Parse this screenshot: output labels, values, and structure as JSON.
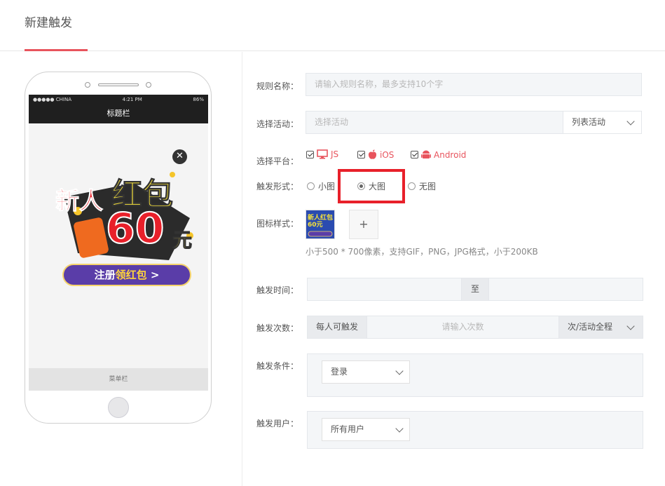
{
  "header": {
    "title": "新建触发"
  },
  "phone": {
    "carrier": "●●●●● CHINA",
    "time": "4:21 PM",
    "battery": "86%",
    "title_bar": "标题栏",
    "menu_bar": "菜单栏",
    "close_glyph": "✕",
    "promo": {
      "line1a": "新人",
      "line1b": "红包",
      "amount": "60",
      "unit": "元",
      "cta": "注册领红包 >",
      "cta_head": "注册",
      "cta_highlight": "领红包",
      "cta_tail": " >"
    }
  },
  "form": {
    "rule_name": {
      "label": "规则名称：",
      "placeholder": "请输入规则名称，最多支持10个字"
    },
    "activity": {
      "label": "选择活动：",
      "placeholder": "选择活动",
      "select_value": "列表活动"
    },
    "platform": {
      "label": "选择平台：",
      "options": [
        {
          "label": "JS",
          "checked": true,
          "icon": "monitor-icon"
        },
        {
          "label": "iOS",
          "checked": true,
          "icon": "apple-icon"
        },
        {
          "label": "Android",
          "checked": true,
          "icon": "android-icon"
        }
      ]
    },
    "trigger_form": {
      "label": "触发形式：",
      "options": [
        {
          "label": "小图",
          "selected": false
        },
        {
          "label": "大图",
          "selected": true
        },
        {
          "label": "无图",
          "selected": false
        }
      ]
    },
    "icon_style": {
      "label": "图标样式：",
      "add_label": "+",
      "hint": "小于500 * 700像素，支持GIF，PNG，JPG格式，小于200KB",
      "thumb_text": "新人红包60元"
    },
    "trigger_time": {
      "label": "触发时间：",
      "separator": "至"
    },
    "trigger_count": {
      "label": "触发次数：",
      "prefix": "每人可触发",
      "placeholder": "请输入次数",
      "select_value": "次/活动全程"
    },
    "trigger_condition": {
      "label": "触发条件：",
      "select_value": "登录"
    },
    "trigger_user": {
      "label": "触发用户：",
      "select_value": "所有用户"
    }
  },
  "colors": {
    "accent": "#e8545d",
    "highlight": "#e8202a"
  }
}
